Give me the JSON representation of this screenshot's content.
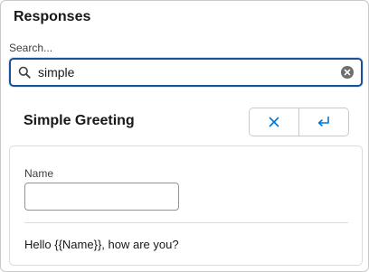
{
  "panel": {
    "title": "Responses"
  },
  "search": {
    "label": "Search...",
    "value": "simple"
  },
  "response": {
    "title": "Simple Greeting",
    "cancel_icon": "close-icon",
    "insert_icon": "enter-return-icon",
    "field": {
      "label": "Name",
      "value": ""
    },
    "preview": "Hello {{Name}}, how are you?"
  },
  "colors": {
    "focus_border": "#1b5297",
    "accent": "#0176d3",
    "border": "#c9c9c9"
  }
}
